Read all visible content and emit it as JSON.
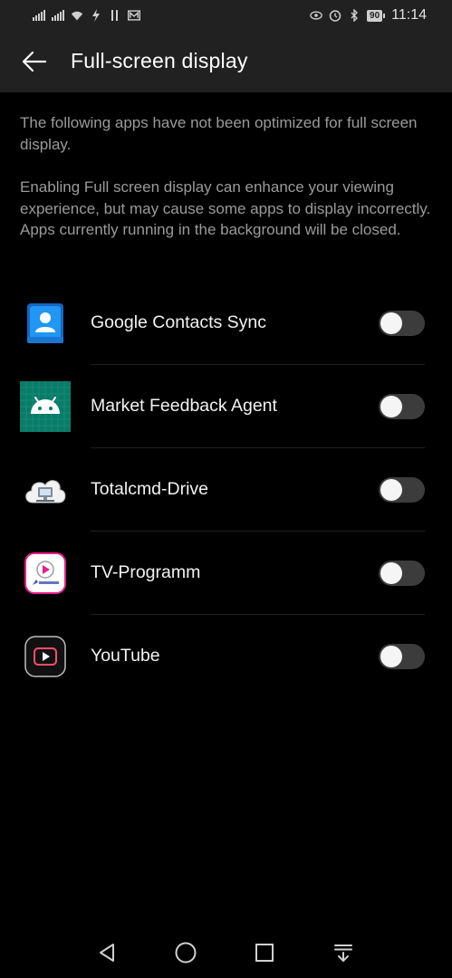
{
  "status_bar": {
    "time": "11:14",
    "battery_level": "90",
    "icons": [
      "signal-icon",
      "signal-icon",
      "wifi-icon",
      "flash-icon",
      "notification-icon",
      "mail-icon",
      "eye-icon",
      "alarm-icon",
      "bluetooth-icon",
      "battery-icon"
    ]
  },
  "header": {
    "title": "Full-screen display",
    "back_icon": "arrow-left-icon"
  },
  "description": {
    "paragraph_1": "The following apps have not been optimized for full screen display.",
    "paragraph_2": "Enabling Full screen display can enhance your viewing experience, but may cause some apps to display incorrectly. Apps currently running in the background will be closed."
  },
  "apps": [
    {
      "name": "Google Contacts Sync",
      "icon": "contacts-sync-icon",
      "enabled": false
    },
    {
      "name": "Market Feedback Agent",
      "icon": "android-icon",
      "enabled": false
    },
    {
      "name": "Totalcmd-Drive",
      "icon": "cloud-drive-icon",
      "enabled": false
    },
    {
      "name": "TV-Programm",
      "icon": "tv-spielfilm-icon",
      "enabled": false
    },
    {
      "name": "YouTube",
      "icon": "youtube-icon",
      "enabled": false
    }
  ],
  "nav_bar": {
    "icons": [
      "nav-back-icon",
      "nav-home-icon",
      "nav-recent-icon",
      "nav-notification-down-icon"
    ]
  },
  "colors": {
    "background": "#000000",
    "app_bar": "#212121",
    "description_text": "#9a9a9a",
    "toggle_off_track": "#3c3c3c",
    "toggle_knob": "#f5f5f5"
  }
}
